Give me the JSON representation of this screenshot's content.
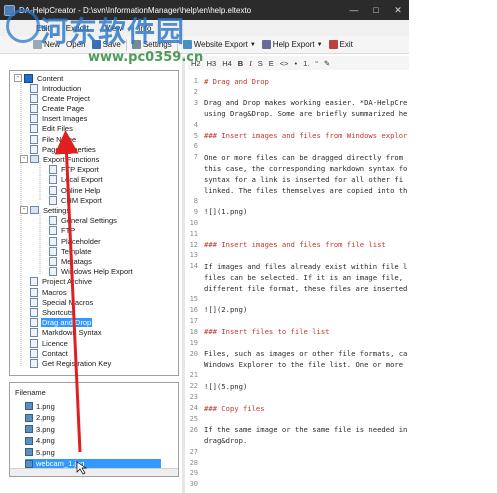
{
  "window": {
    "title": "DA-HelpCreator - D:\\svn\\InformationManager\\help\\en\\help.eltexto"
  },
  "watermark": {
    "text": "河东软件园",
    "url": "www.pc0359.cn"
  },
  "menu": [
    "Edit",
    "Export",
    "View",
    "Info"
  ],
  "toolbar": {
    "new_label": "New",
    "open_label": "Open",
    "save_label": "Save",
    "settings_label": "Settings",
    "website_export_label": "Website Export",
    "help_export_label": "Help Export",
    "exit_label": "Exit"
  },
  "format_toolbar": [
    "H2",
    "H3",
    "H4",
    "B",
    "I",
    "S",
    "E",
    "<>",
    "•",
    "1.",
    "“",
    "✎"
  ],
  "tree": {
    "root": "Content",
    "items": [
      {
        "label": "Introduction"
      },
      {
        "label": "Create Project"
      },
      {
        "label": "Create Page"
      },
      {
        "label": "Insert Images"
      },
      {
        "label": "Edit Files"
      },
      {
        "label": "File Name"
      },
      {
        "label": "Page Properties"
      },
      {
        "label": "Export Functions"
      },
      {
        "label": "FTP Export"
      },
      {
        "label": "Local Export"
      },
      {
        "label": "Online Help"
      },
      {
        "label": "CHM Export"
      },
      {
        "label": "Settings"
      },
      {
        "label": "General Settings"
      },
      {
        "label": "FTP"
      },
      {
        "label": "Placeholder"
      },
      {
        "label": "Template"
      },
      {
        "label": "Metatags"
      },
      {
        "label": "Windows Help Export"
      },
      {
        "label": "Project Archive"
      },
      {
        "label": "Macros"
      },
      {
        "label": "Special Macros"
      },
      {
        "label": "Shortcuts"
      },
      {
        "label": "Drag and Drop",
        "selected": true
      },
      {
        "label": "Markdown Syntax"
      },
      {
        "label": "Licence"
      },
      {
        "label": "Contact"
      },
      {
        "label": "Get Registration Key"
      }
    ]
  },
  "files": {
    "header": "Filename",
    "items": [
      {
        "name": "1.png"
      },
      {
        "name": "2.png"
      },
      {
        "name": "3.png"
      },
      {
        "name": "4.png"
      },
      {
        "name": "5.png"
      },
      {
        "name": "webcam_1.jpg",
        "selected": true
      }
    ]
  },
  "editor": {
    "lines": [
      {
        "n": "1",
        "t": "# Drag and Drop",
        "h": true
      },
      {
        "n": "2",
        "t": ""
      },
      {
        "n": "3",
        "t": "Drag and Drop makes working easier. *DA-HelpCre"
      },
      {
        "n": "",
        "t": "using Drag&Drop. Some are briefly summarized he"
      },
      {
        "n": "4",
        "t": ""
      },
      {
        "n": "5",
        "t": "### Insert images and files from Windows explor",
        "h": true
      },
      {
        "n": "6",
        "t": ""
      },
      {
        "n": "7",
        "t": "One or more files can be dragged directly from"
      },
      {
        "n": "",
        "t": "this case, the corresponding markdown syntax fo"
      },
      {
        "n": "",
        "t": "syntax for a link is inserted for all other fi"
      },
      {
        "n": "",
        "t": "linked. The files themselves are copied into th"
      },
      {
        "n": "8",
        "t": ""
      },
      {
        "n": "9",
        "t": "![](1.png)"
      },
      {
        "n": "10",
        "t": ""
      },
      {
        "n": "11",
        "t": ""
      },
      {
        "n": "12",
        "t": "### Insert images and files from file list",
        "h": true
      },
      {
        "n": "13",
        "t": ""
      },
      {
        "n": "14",
        "t": "If images and files already exist within file l"
      },
      {
        "n": "",
        "t": "files can be selected. If it is an image file,"
      },
      {
        "n": "",
        "t": "different file format, these files are inserted"
      },
      {
        "n": "15",
        "t": ""
      },
      {
        "n": "16",
        "t": "![](2.png)"
      },
      {
        "n": "17",
        "t": ""
      },
      {
        "n": "18",
        "t": "### Insert files to file list",
        "h": true
      },
      {
        "n": "19",
        "t": ""
      },
      {
        "n": "20",
        "t": "Files, such as images or other file formats, ca"
      },
      {
        "n": "",
        "t": "Windows Explorer to the file list. One or more"
      },
      {
        "n": "21",
        "t": ""
      },
      {
        "n": "22",
        "t": "![](5.png)"
      },
      {
        "n": "23",
        "t": ""
      },
      {
        "n": "24",
        "t": "### Copy files",
        "h": true
      },
      {
        "n": "25",
        "t": ""
      },
      {
        "n": "26",
        "t": "If the same image or the same file is needed in"
      },
      {
        "n": "",
        "t": "drag&drop."
      },
      {
        "n": "27",
        "t": ""
      },
      {
        "n": "28",
        "t": ""
      },
      {
        "n": "29",
        "t": ""
      },
      {
        "n": "30",
        "t": ""
      }
    ]
  },
  "colors": {
    "accent": "#3399ff",
    "arrow": "#e02020",
    "heading": "#c0392b"
  }
}
